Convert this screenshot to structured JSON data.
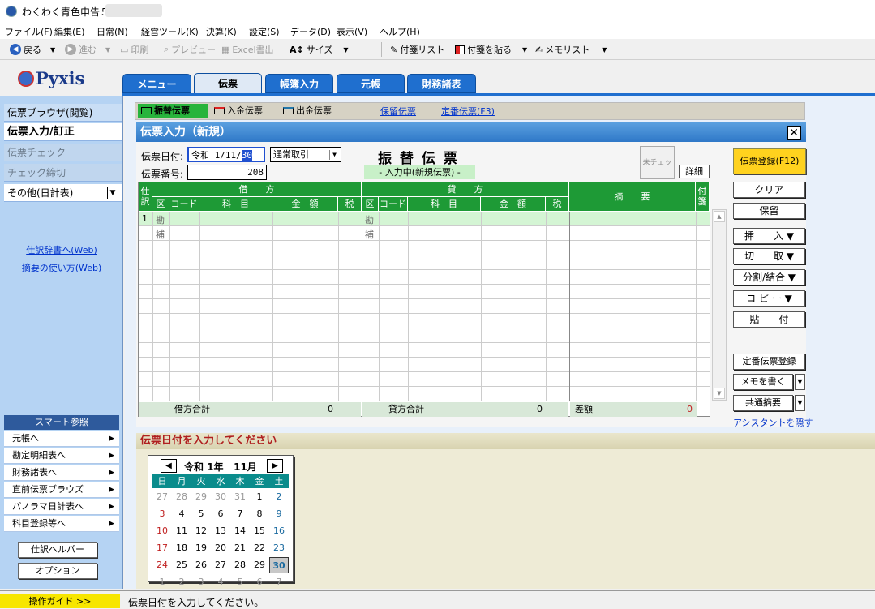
{
  "window": {
    "title": "わくわく青色申告５ -"
  },
  "menu": [
    "ファイル(F)",
    "編集(E)",
    "日常(N)",
    "経営ツール(K)",
    "決算(K)",
    "設定(S)",
    "データ(D)",
    "表示(V)",
    "ヘルプ(H)"
  ],
  "toolbar": {
    "back": "戻る",
    "forward": "進む",
    "print": "印刷",
    "preview": "プレビュー",
    "excel": "Excel書出",
    "size": "サイズ",
    "tag_list": "付箋リスト",
    "tag_paste": "付箋を貼る",
    "memo_list": "メモリスト"
  },
  "logo": "Pyxis",
  "nav_tabs": [
    "メニュー",
    "伝票",
    "帳簿入力",
    "元帳",
    "財務諸表"
  ],
  "sidebar": {
    "items": [
      "伝票ブラウザ(閲覧)",
      "伝票入力/訂正",
      "伝票チェック",
      "チェック締切",
      "その他(日計表)"
    ],
    "links": [
      "仕訳辞書へ(Web)",
      "摘要の使い方(Web)"
    ],
    "smart_title": "スマート参照",
    "smart_items": [
      "元帳へ",
      "勘定明細表へ",
      "財務諸表へ",
      "直前伝票ブラウズ",
      "パノラマ日計表へ",
      "科目登録等へ"
    ],
    "buttons": [
      "仕訳ヘルパー",
      "オプション"
    ]
  },
  "voucher_tabs": {
    "active": "振替伝票",
    "in": "入金伝票",
    "out": "出金伝票",
    "hold": "保留伝票",
    "fixed": "定番伝票(F3)"
  },
  "form": {
    "title": "伝票入力（新規）",
    "date_label": "伝票日付:",
    "date_value": "令和 1/11/",
    "date_selected": "30",
    "trade_type": "通常取引",
    "number_label": "伝票番号:",
    "number_value": "208",
    "voucher_title": "振 替 伝 票",
    "status": "- 入力中(新規伝票) -",
    "check_stamp": "未チェック",
    "detail_btn": "詳細"
  },
  "grid": {
    "h_shiwake": "仕訳",
    "debit": "借　　方",
    "credit": "貸　　方",
    "memo": "摘　　要",
    "tag": "付箋",
    "sub": {
      "ku": "区",
      "code": "コード",
      "item": "科　目",
      "amount": "金　額",
      "tax": "税"
    },
    "row_no": "1",
    "kan": "勘",
    "ho": "補",
    "debit_total_label": "借方合計",
    "debit_total": "0",
    "credit_total_label": "貸方合計",
    "credit_total": "0",
    "diff_label": "差額",
    "diff": "0"
  },
  "right_buttons": {
    "register": "伝票登録(F12)",
    "clear": "クリア",
    "hold": "保留",
    "insert": "挿　　入 ▼",
    "cut": "切　　取 ▼",
    "split": "分割/結合 ▼",
    "copy": "コ ピ ー ▼",
    "paste": "貼　　付",
    "fixed_reg": "定番伝票登録",
    "memo": "メモを書く",
    "common": "共通摘要",
    "hide_assist": "アシスタントを隠す"
  },
  "guide": {
    "title": "伝票日付を入力してください"
  },
  "calendar": {
    "era": "令和",
    "year": "1年",
    "month": "11月",
    "weekdays": [
      "日",
      "月",
      "火",
      "水",
      "木",
      "金",
      "土"
    ],
    "weeks": [
      [
        "27",
        "28",
        "29",
        "30",
        "31",
        "1",
        "2"
      ],
      [
        "3",
        "4",
        "5",
        "6",
        "7",
        "8",
        "9"
      ],
      [
        "10",
        "11",
        "12",
        "13",
        "14",
        "15",
        "16"
      ],
      [
        "17",
        "18",
        "19",
        "20",
        "21",
        "22",
        "23"
      ],
      [
        "24",
        "25",
        "26",
        "27",
        "28",
        "29",
        "30"
      ],
      [
        "1",
        "2",
        "3",
        "4",
        "5",
        "6",
        "7"
      ]
    ],
    "selected": "30"
  },
  "statusbar": {
    "guide": "操作ガイド >>",
    "text": "伝票日付を入力してください。"
  }
}
